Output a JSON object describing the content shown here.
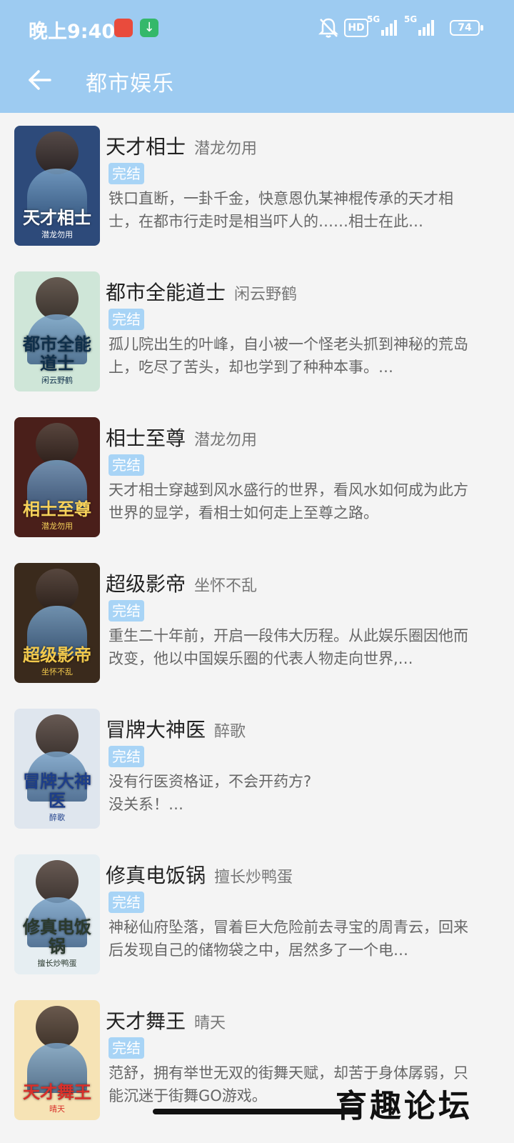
{
  "status": {
    "time": "晚上9:40",
    "hd": "HD",
    "net1": "5G",
    "net2": "5G",
    "battery": "74"
  },
  "header": {
    "title": "都市娱乐"
  },
  "badge_label": "完结",
  "books": [
    {
      "title": "天才相士",
      "author": "潜龙勿用",
      "status": "完结",
      "desc": "铁口直断，一卦千金，快意恩仇某神棍传承的天才相士，在都市行走时是相当吓人的……相士在此…",
      "cover_text": "天才相士",
      "cover_author": "潜龙勿用",
      "cover_bg": "#2d4a7a",
      "cover_fg": "#ffffff"
    },
    {
      "title": "都市全能道士",
      "author": "闲云野鹤",
      "status": "完结",
      "desc": "孤儿院出生的叶峰，自小被一个怪老头抓到神秘的荒岛上，吃尽了苦头，却也学到了种种本事。…",
      "cover_text": "都市全能道士",
      "cover_author": "闲云野鹤",
      "cover_bg": "#cfe6d8",
      "cover_fg": "#0f2f4a"
    },
    {
      "title": "相士至尊",
      "author": "潜龙勿用",
      "status": "完结",
      "desc": "天才相士穿越到风水盛行的世界，看风水如何成为此方世界的显学，看相士如何走上至尊之路。",
      "cover_text": "相士至尊",
      "cover_author": "潜龙勿用",
      "cover_bg": "#4a1f1a",
      "cover_fg": "#f7d25a"
    },
    {
      "title": "超级影帝",
      "author": "坐怀不乱",
      "status": "完结",
      "desc": "重生二十年前，开启一段伟大历程。从此娱乐圈因他而改变，他以中国娱乐圈的代表人物走向世界,…",
      "cover_text": "超级影帝",
      "cover_author": "坐怀不乱",
      "cover_bg": "#3a2a1c",
      "cover_fg": "#f2c94c"
    },
    {
      "title": "冒牌大神医",
      "author": "醉歌",
      "status": "完结",
      "desc": "没有行医资格证，不会开药方?\n没关系！…",
      "cover_text": "冒牌大神医",
      "cover_author": "醉歌",
      "cover_bg": "#dfe6ee",
      "cover_fg": "#1d3e8a"
    },
    {
      "title": "修真电饭锅",
      "author": "擅长炒鸭蛋",
      "status": "完结",
      "desc": "神秘仙府坠落，冒着巨大危险前去寻宝的周青云，回来后发现自己的储物袋之中，居然多了一个电…",
      "cover_text": "修真电饭锅",
      "cover_author": "擅长炒鸭蛋",
      "cover_bg": "#e6eef2",
      "cover_fg": "#2b3a2f"
    },
    {
      "title": "天才舞王",
      "author": "晴天",
      "status": "完结",
      "desc": "范舒，拥有举世无双的街舞天赋，却苦于身体孱弱，只能沉迷于街舞GO游戏。",
      "cover_text": "天才舞王",
      "cover_author": "晴天",
      "cover_bg": "#f6e3b5",
      "cover_fg": "#d8302a"
    }
  ],
  "watermark": "育趣论坛"
}
